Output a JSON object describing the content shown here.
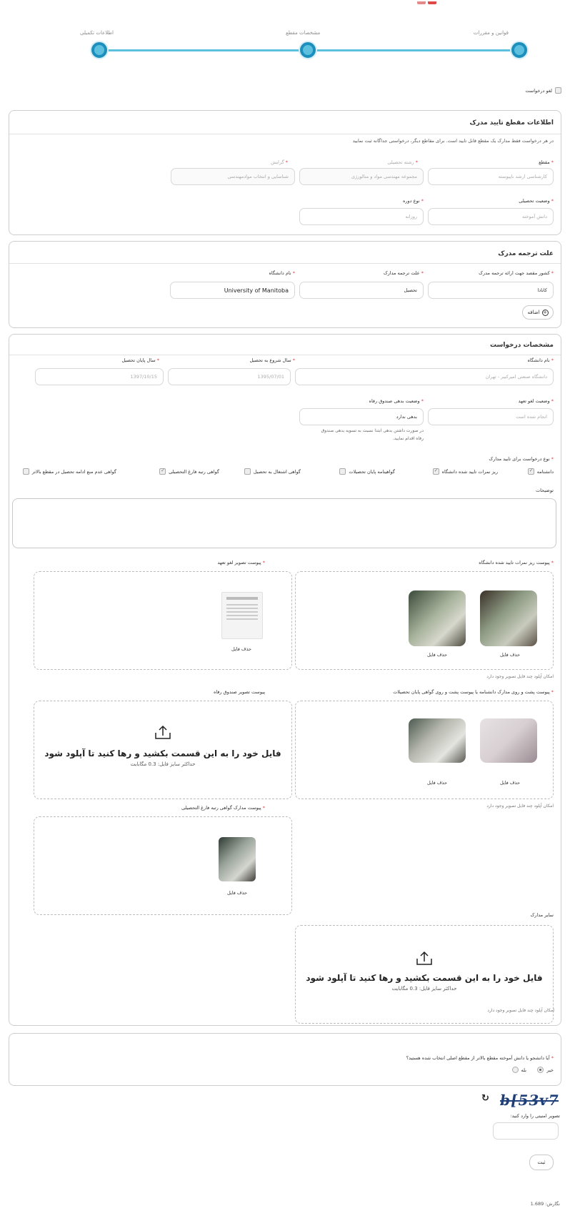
{
  "stepper": {
    "steps": [
      "قوانین و مقررات",
      "مشخصات مقطع",
      "اطلاعات تکمیلی"
    ]
  },
  "cancel_request": {
    "label": "لغو درخواست"
  },
  "section_degree": {
    "title": "اطلاعات مقطع تایید مدرک",
    "note": "در هر درخواست فقط مدارک یک مقطع قابل تایید است. برای مقاطع دیگر، درخواستی جداگانه ثبت نمایید",
    "grade_label": "مقطع",
    "grade_value": "کارشناسی ارشد ناپیوسته",
    "field_label": "رشته تحصیلی",
    "field_value": "مجموعه مهندسی مواد و متالورژی",
    "branch_label": "گرایش",
    "branch_value": "شناسایی و انتخاب موادمهندسی",
    "status_label": "وضعیت تحصیلی",
    "status_value": "دانش آموخته",
    "course_label": "نوع دوره",
    "course_value": "روزانه"
  },
  "section_translation": {
    "title": "علت ترجمه مدرک",
    "country_label": "کشور مقصد جهت ارائه ترجمه مدرک",
    "country_value": "کانادا",
    "reason_label": "علت ترجمه مدارک",
    "reason_value": "تحصیل",
    "university_label": "نام دانشگاه",
    "university_value": "University of Manitoba",
    "add_label": "اضافه"
  },
  "section_request": {
    "title": "مشخصات درخواست",
    "uni_label": "نام دانشگاه",
    "uni_value": "دانشگاه صنعتی امیرکبیر - تهران",
    "start_label": "سال شروع به تحصیل",
    "start_value": "1395/07/01",
    "end_label": "سال پایان تحصیل",
    "end_value": "1397/10/15",
    "pledge_label": "وضعیت لغو تعهد",
    "pledge_value": "انجام شده است",
    "fund_label": "وضعیت بدهی صندوق رفاه",
    "fund_value": "بدهی ندارد",
    "fund_help_1": "در صورت داشتن بدهی ابتدا نسبت به تسویه بدهی صندوق",
    "fund_help_2": "رفاه اقدام نمایید.",
    "doc_type_label": "نوع درخواست برای تایید مدارک",
    "doc_types": [
      {
        "label": "دانشنامه",
        "checked": true
      },
      {
        "label": "ریز نمرات تایید شده دانشگاه",
        "checked": true
      },
      {
        "label": "گواهینامه پایان تحصیلات",
        "checked": false
      },
      {
        "label": "گواهی اشتغال به تحصیل",
        "checked": false
      },
      {
        "label": "گواهی رتبه فارغ التحصیلی",
        "checked": true
      },
      {
        "label": "گواهی عدم منع ادامه تحصیل در مقطع بالاتر",
        "checked": false
      }
    ],
    "desc_label": "توضیحات"
  },
  "uploads": {
    "transcript_label": "پیوست ریز نمرات تایید شده دانشگاه",
    "pledge_img_label": "پیوست تصویر لغو تعهد",
    "diploma_label": "پیوست پشت و روی مدارک دانشنامه یا پیوست پشت و روی گواهی پایان تحصیلات",
    "fund_img_label": "پیوست تصویر صندوق رفاه",
    "rank_label": "پیوست مدارک گواهی رتبه فارغ التحصیلی",
    "other_label": "سایر مدارک",
    "delete_label": "حذف فایل",
    "multi_note": "امکان آپلود چند فایل تصویر وجود دارد",
    "drop_title": "فایل خود را به این قسمت بکشید و رها کنید تا آپلود شود",
    "drop_sub": "حداکثر سایز فایل: 0.3 مگابایت"
  },
  "question": {
    "text": "آیا دانشجو یا دانش آموخته مقطع بالاتر از مقطع اصلی انتخاب شده هستید؟",
    "no": "خیر",
    "yes": "بله"
  },
  "captcha": {
    "code": "b[53v7",
    "label": "تصویر امنیتی را وارد کنید:"
  },
  "submit_label": "ثبت",
  "version": "نگارش: 1.689",
  "colors": {
    "accent": "#5ec0df",
    "accent_dark": "#1c8fbc",
    "required": "#e03a3a"
  }
}
